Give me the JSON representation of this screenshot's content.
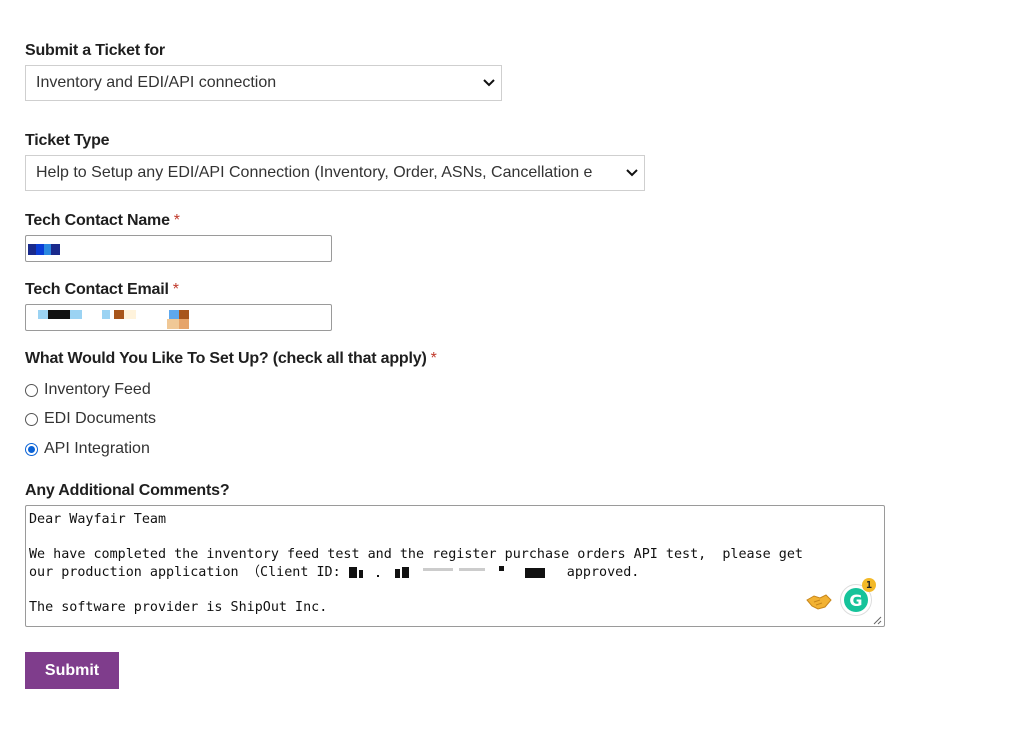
{
  "form": {
    "submit_ticket_for": {
      "label": "Submit a Ticket for",
      "value": "Inventory and EDI/API connection"
    },
    "ticket_type": {
      "label": "Ticket Type",
      "value": "Help to Setup any EDI/API Connection (Inventory, Order, ASNs, Cancellation e"
    },
    "tech_contact_name": {
      "label": "Tech Contact Name",
      "required": "*"
    },
    "tech_contact_email": {
      "label": "Tech Contact Email",
      "required": "*"
    },
    "setup": {
      "label": "What Would You Like To Set Up? (check all that apply)",
      "required": "*",
      "options": [
        {
          "label": "Inventory Feed",
          "checked": false
        },
        {
          "label": "EDI Documents",
          "checked": false
        },
        {
          "label": "API Integration",
          "checked": true
        }
      ]
    },
    "comments": {
      "label": "Any Additional Comments?",
      "line1": "Dear Wayfair Team",
      "line2": "We have completed the inventory feed test and the register purchase orders API test,  please get",
      "line3_prefix": "our production application （Client ID: ",
      "line3_suffix": " approved.",
      "line4": "The software provider is ShipOut Inc."
    },
    "grammarly_count": "1",
    "submit_label": "Submit"
  },
  "colors": {
    "submit_bg": "#7f3d8c",
    "required": "#c0392b",
    "radio_checked": "#0b63d6"
  },
  "icons": [
    "chevron-down-icon",
    "handshake-icon",
    "grammarly-icon",
    "resize-handle-icon"
  ]
}
